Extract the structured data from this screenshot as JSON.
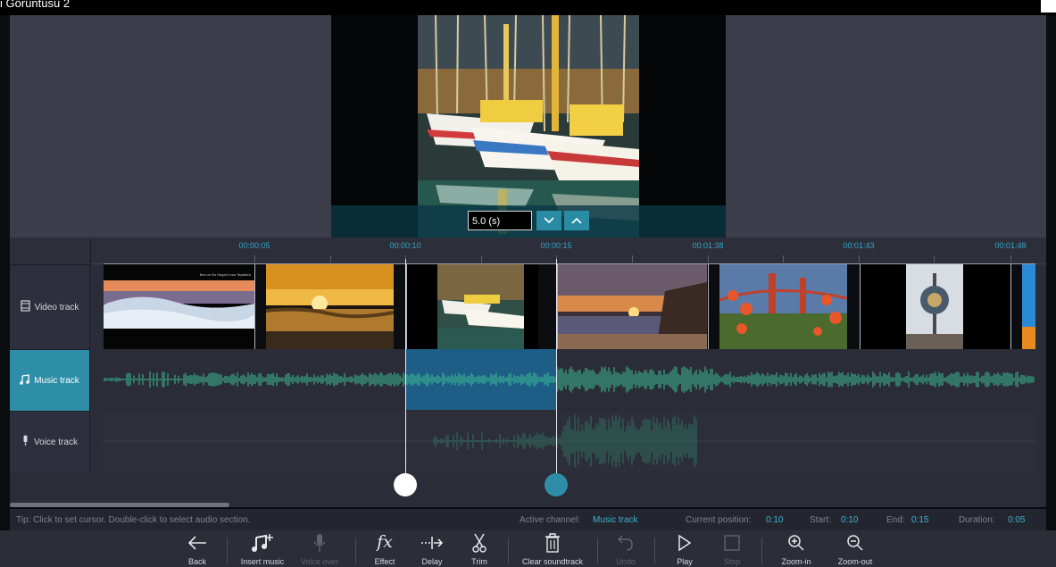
{
  "window": {
    "title": "i Görüntüsü 2"
  },
  "preview": {
    "duration_value": "5.0 (s)",
    "down_icon": "chevron-down-icon",
    "up_icon": "chevron-up-icon"
  },
  "ruler": {
    "labels": [
      "00:00:05",
      "00:00:10",
      "00:00:15",
      "00:01:38",
      "00:01:43",
      "00:01:48"
    ]
  },
  "tracks": {
    "video": {
      "label": "Video track",
      "icon": "film-icon"
    },
    "music": {
      "label": "Music track",
      "icon": "music-note-icon"
    },
    "voice": {
      "label": "Voice track",
      "icon": "microphone-icon"
    }
  },
  "clips": [
    {
      "name": "clip-clouds-sunset",
      "caption": "Ben ve Bu Hayatı Kısa Teşekkür"
    },
    {
      "name": "clip-sea-sunset"
    },
    {
      "name": "clip-boats"
    },
    {
      "name": "clip-beach-sunset"
    },
    {
      "name": "clip-golden-gate-flowers"
    },
    {
      "name": "clip-wharf-sign"
    },
    {
      "name": "clip-partial"
    }
  ],
  "status": {
    "tip": "Tip: Click to set cursor. Double-click to select audio section.",
    "active_channel_label": "Active channel:",
    "active_channel_value": "Music track",
    "current_position_label": "Current position:",
    "current_position_value": "0:10",
    "start_label": "Start:",
    "start_value": "0:10",
    "end_label": "End:",
    "end_value": "0:15",
    "duration_label": "Duration:",
    "duration_value": "0:05"
  },
  "toolbar": {
    "back": "Back",
    "insert_music": "Insert music",
    "voice_over": "Voice over",
    "effect": "Effect",
    "delay": "Delay",
    "trim": "Trim",
    "clear_soundtrack": "Clear soundtrack",
    "undo": "Undo",
    "play": "Play",
    "stop": "Stop",
    "zoom_in": "Zoom-in",
    "zoom_out": "Zoom-out"
  },
  "colors": {
    "accent": "#2f8ea7",
    "waveform": "#3fbf95",
    "selection": "#1d5d86",
    "status_value": "#3cb0d4"
  }
}
